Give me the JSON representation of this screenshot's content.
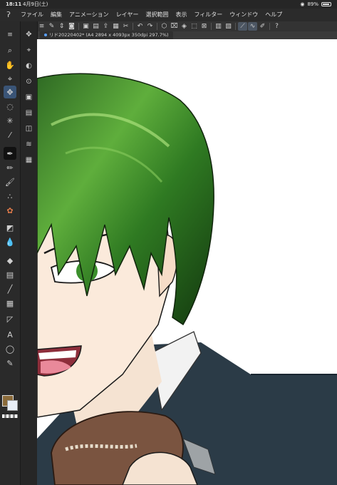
{
  "status": {
    "time": "18:11",
    "date": "4月9日(土)",
    "battery": "89%"
  },
  "menu": {
    "logo_icon": "clip-studio-icon",
    "items": [
      "ファイル",
      "編集",
      "アニメーション",
      "レイヤー",
      "選択範囲",
      "表示",
      "フィルター",
      "ウィンドウ",
      "ヘルプ"
    ]
  },
  "command_bar": {
    "icons": [
      "menu-icon",
      "new-icon",
      "spinner-icon",
      "camera-icon",
      "save-icon",
      "open-icon",
      "export-icon",
      "paste-icon",
      "cut-icon",
      "undo-icon",
      "redo-icon",
      "transform-icon",
      "clear-icon",
      "fill-icon",
      "select-icon",
      "deselect-icon",
      "grid-icon",
      "ruler-icon",
      "stroke-icon",
      "smooth-icon",
      "pen-settings-icon",
      "help-icon"
    ]
  },
  "document_tab": {
    "label": "リド20220402* (A4 2894 x 4093px 350dpi 297.7%)"
  },
  "tools": [
    "zoom-icon",
    "hand-icon",
    "eyedropper-icon",
    "move-icon",
    "lasso-icon",
    "wand-icon",
    "eyedropper2-icon",
    "pen-icon",
    "pencil-icon",
    "brush-icon",
    "airbrush-icon",
    "decoration-icon",
    "eraser-icon",
    "blend-icon",
    "fill-icon",
    "gradient-icon",
    "line-icon",
    "frame-icon",
    "ruler-icon",
    "text-icon",
    "balloon-icon",
    "correct-line-icon"
  ],
  "text_tool_glyph": "A",
  "colors": {
    "main": "#8b6b3a",
    "sub": "#e8eef6",
    "accent": "#3a5476"
  }
}
